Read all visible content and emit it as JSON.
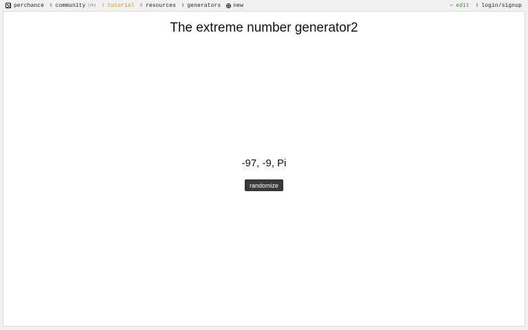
{
  "topbar": {
    "left": [
      {
        "name": "perchance",
        "label": "perchance",
        "icon": "die-icon"
      },
      {
        "name": "community",
        "label": "community",
        "badge": "(2h)",
        "icon": "chat-icon"
      },
      {
        "name": "tutorial",
        "label": "tutorial",
        "icon": "book-icon",
        "color": "#d88a1c"
      },
      {
        "name": "resources",
        "label": "resources",
        "icon": "folder-icon"
      },
      {
        "name": "generators",
        "label": "generators",
        "icon": "list-icon"
      },
      {
        "name": "new",
        "label": "new",
        "icon": "globe-plus-icon"
      }
    ],
    "right": [
      {
        "name": "edit",
        "label": "edit",
        "icon": "pencil-icon",
        "color": "#2f8f2f"
      },
      {
        "name": "login",
        "label": "login/signup",
        "icon": "user-icon"
      }
    ]
  },
  "generator": {
    "title": "The extreme number generator2",
    "output": "-97, -9, Pi",
    "button_label": "randomize"
  }
}
